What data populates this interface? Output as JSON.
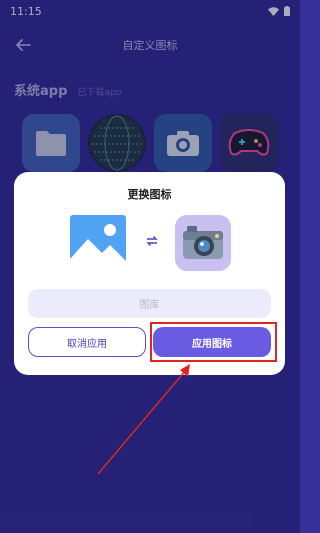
{
  "status_bar": {
    "time": "11:15"
  },
  "header": {
    "title": "自定义图标"
  },
  "tabs": [
    {
      "label": "系统app"
    },
    {
      "label": "已下载app"
    }
  ],
  "dialog": {
    "title": "更换图标",
    "gallery_label": "图库",
    "cancel_label": "取消应用",
    "apply_label": "应用图标"
  },
  "colors": {
    "background": "#2e2a96",
    "accent": "#6a5be3",
    "annotation": "#e0261d"
  }
}
